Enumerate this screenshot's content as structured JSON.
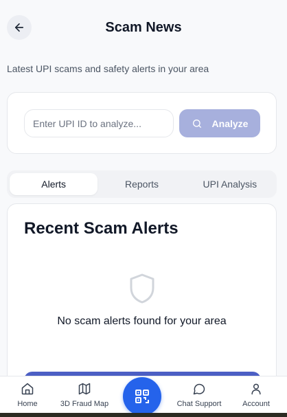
{
  "header": {
    "title": "Scam News",
    "subtitle": "Latest UPI scams and safety alerts in your area"
  },
  "search": {
    "placeholder": "Enter UPI ID to analyze...",
    "button_label": "Analyze"
  },
  "tabs": [
    {
      "label": "Alerts",
      "active": true
    },
    {
      "label": "Reports",
      "active": false
    },
    {
      "label": "UPI Analysis",
      "active": false
    }
  ],
  "alerts": {
    "title": "Recent Scam Alerts",
    "empty_message": "No scam alerts found for your area"
  },
  "nav": {
    "items": [
      {
        "label": "Home",
        "icon": "home-icon"
      },
      {
        "label": "3D Fraud Map",
        "icon": "map-icon"
      },
      {
        "label": "",
        "icon": "qr-code-icon"
      },
      {
        "label": "Chat Support",
        "icon": "chat-icon"
      },
      {
        "label": "Account",
        "icon": "user-icon"
      }
    ]
  },
  "colors": {
    "accent": "#2563eb",
    "analyze_button": "#a7b0dd",
    "card_border": "#e5e7eb"
  }
}
